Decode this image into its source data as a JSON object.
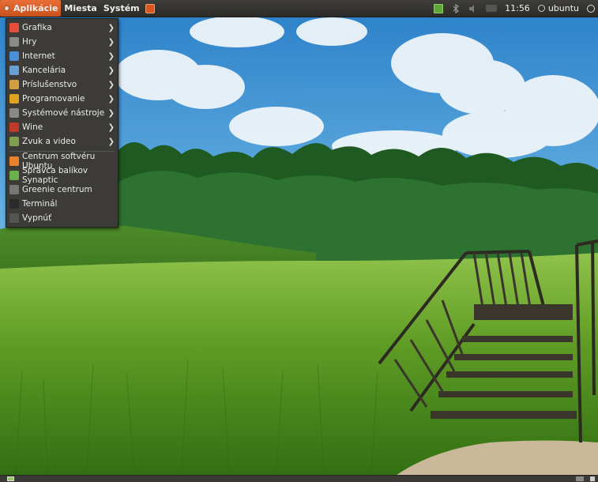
{
  "panel": {
    "menus": [
      {
        "label": "Aplikácie"
      },
      {
        "label": "Miesta"
      },
      {
        "label": "Systém"
      }
    ],
    "clock": "11:56",
    "user": "ubuntu"
  },
  "applications_menu": {
    "categories": [
      {
        "label": "Grafika",
        "icon": "graphics-icon",
        "color": "#e74c3c"
      },
      {
        "label": "Hry",
        "icon": "games-icon",
        "color": "#8a8a8a"
      },
      {
        "label": "Internet",
        "icon": "internet-icon",
        "color": "#4a90d9"
      },
      {
        "label": "Kancelária",
        "icon": "office-icon",
        "color": "#6a9fd4"
      },
      {
        "label": "Príslušenstvo",
        "icon": "accessories-icon",
        "color": "#d0a040"
      },
      {
        "label": "Programovanie",
        "icon": "programming-icon",
        "color": "#e0a020"
      },
      {
        "label": "Systémové nástroje",
        "icon": "system-tools-icon",
        "color": "#888888"
      },
      {
        "label": "Wine",
        "icon": "wine-icon",
        "color": "#c0392b"
      },
      {
        "label": "Zvuk a video",
        "icon": "sound-video-icon",
        "color": "#7fa050"
      }
    ],
    "launchers": [
      {
        "label": "Centrum softvéru Ubuntu",
        "icon": "software-center-icon",
        "color": "#e8822a"
      },
      {
        "label": "Správca balíkov Synaptic",
        "icon": "synaptic-icon",
        "color": "#6ab04c"
      },
      {
        "label": "Greenie centrum",
        "icon": "greenie-center-icon",
        "color": "#777777"
      },
      {
        "label": "Terminál",
        "icon": "terminal-icon",
        "color": "#2b2b2b"
      },
      {
        "label": "Vypnúť",
        "icon": "shutdown-icon",
        "color": "#555555"
      }
    ]
  }
}
